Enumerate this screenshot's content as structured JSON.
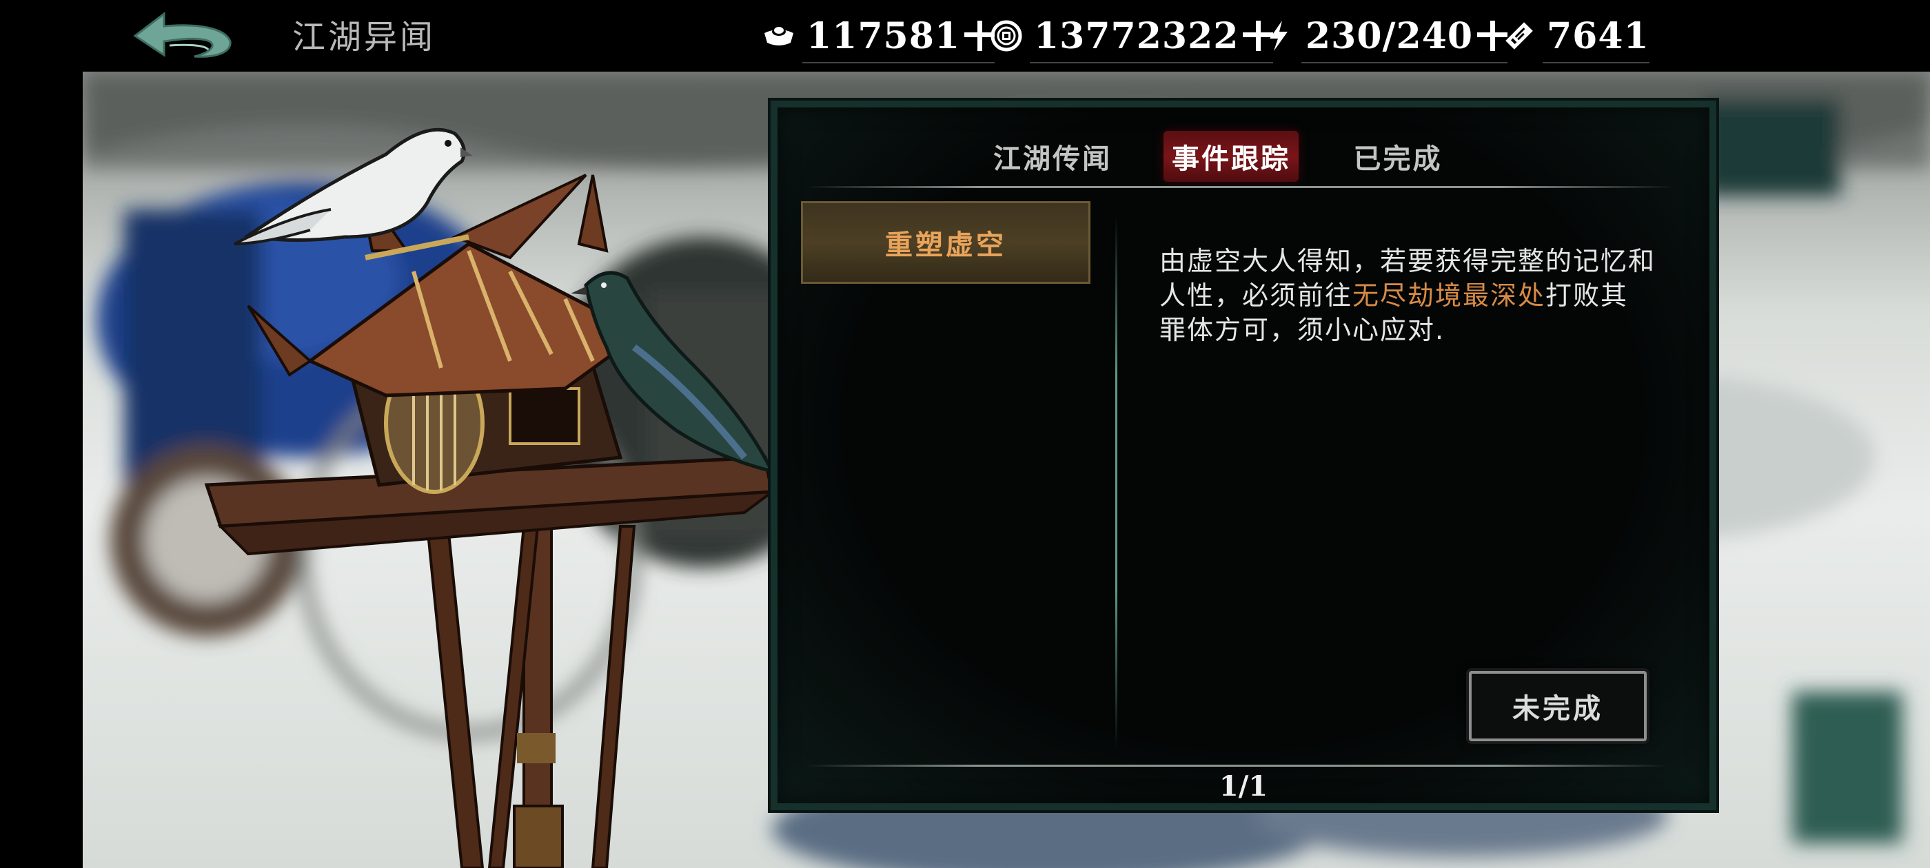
{
  "header": {
    "title": "江湖异闻"
  },
  "resources": [
    {
      "name": "silver",
      "icon": "silver-ingot-icon",
      "value": "117581"
    },
    {
      "name": "coins",
      "icon": "copper-coin-icon",
      "value": "13772322"
    },
    {
      "name": "stamina",
      "icon": "lightning-icon",
      "value": "230/240"
    },
    {
      "name": "tickets",
      "icon": "ticket-icon",
      "value": "7641"
    }
  ],
  "tabs": [
    {
      "label": "江湖传闻",
      "active": false
    },
    {
      "label": "事件跟踪",
      "active": true
    },
    {
      "label": "已完成",
      "active": false
    }
  ],
  "quest_list": [
    {
      "label": "重塑虚空",
      "selected": true
    }
  ],
  "description": {
    "part1": "由虚空大人得知，若要获得完整的记忆和人性，必须前往",
    "highlight": "无尽劫境最深处",
    "part2": "打败其罪体方可，须小心应对."
  },
  "status_button": {
    "label": "未完成"
  },
  "pagination": {
    "text": "1/1"
  },
  "colors": {
    "highlight_text": "#d78b47",
    "active_tab": "#7a1519",
    "panel_border": "#16302b"
  }
}
